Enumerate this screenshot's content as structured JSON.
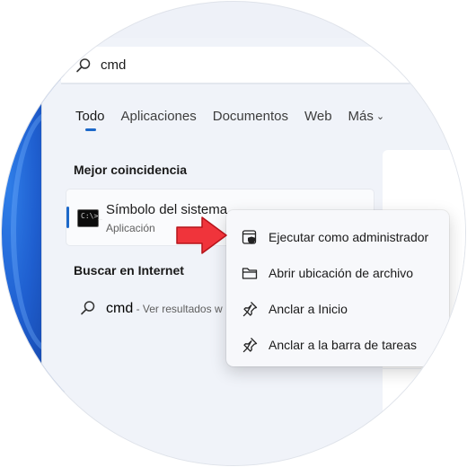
{
  "search": {
    "query": "cmd"
  },
  "tabs": [
    {
      "label": "Todo"
    },
    {
      "label": "Aplicaciones"
    },
    {
      "label": "Documentos"
    },
    {
      "label": "Web"
    },
    {
      "label": "Más"
    }
  ],
  "best_match": {
    "heading": "Mejor coincidencia",
    "name": "Símbolo del sistema",
    "type": "Aplicación",
    "icon_text": "C:\\>_",
    "icon": "command-prompt-icon"
  },
  "web_search": {
    "heading": "Buscar en Internet",
    "query": "cmd",
    "hint": " - Ver resultados w"
  },
  "context_menu": {
    "items": [
      {
        "label": "Ejecutar como administrador",
        "icon": "admin-shield-icon"
      },
      {
        "label": "Abrir ubicación de archivo",
        "icon": "folder-icon"
      },
      {
        "label": "Anclar a Inicio",
        "icon": "pin-icon"
      },
      {
        "label": "Anclar a la barra de tareas",
        "icon": "pin-icon"
      }
    ]
  },
  "colors": {
    "accent": "#1c68c9",
    "arrow": "#f0343b",
    "panel": "#f0f3f9",
    "menu": "#f7f8fb"
  }
}
